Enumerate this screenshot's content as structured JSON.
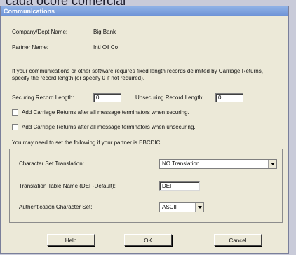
{
  "background": {
    "caption": "cada ocore comercial"
  },
  "window": {
    "title": "Communications"
  },
  "info": {
    "company_label": "Company/Dept Name:",
    "company_value": "Big Bank",
    "partner_label": "Partner Name:",
    "partner_value": "Intl Oil Co"
  },
  "record": {
    "description": "If your communications or other software requires fixed length records delimited by Carriage Returns, specify the record length (or specify 0 if not required).",
    "securing_label": "Securing Record Length:",
    "securing_value": "0",
    "unsecuring_label": "Unsecuring Record Length:",
    "unsecuring_value": "0"
  },
  "options": {
    "cr_securing_label": "Add Carriage Returns after all message terminators when securing.",
    "cr_securing_checked": false,
    "cr_unsecuring_label": "Add Carriage Returns after all message terminators when unsecuring.",
    "cr_unsecuring_checked": false
  },
  "ebcdic": {
    "note": "You may need to set the following if your partner is EBCDIC:",
    "charset_label": "Character Set Translation:",
    "charset_value": "NO Translation",
    "table_label": "Translation Table Name (DEF-Default):",
    "table_value": "DEF",
    "auth_label": "Authentication Character Set:",
    "auth_value": "ASCII"
  },
  "buttons": {
    "help": "Help",
    "ok": "OK",
    "cancel": "Cancel"
  }
}
